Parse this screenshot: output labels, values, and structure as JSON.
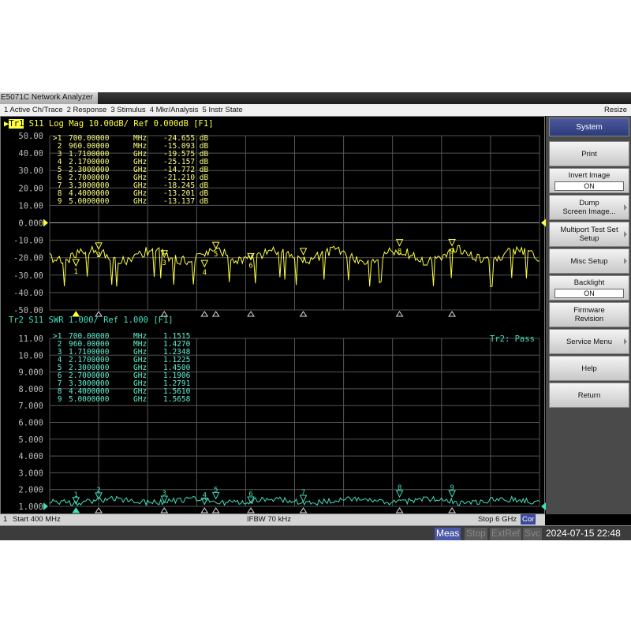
{
  "window": {
    "title": "E5071C Network Analyzer"
  },
  "menu": {
    "items": [
      "1 Active Ch/Trace",
      "2 Response",
      "3 Stimulus",
      "4 Mkr/Analysis",
      "5 Instr State"
    ],
    "resize": "Resize"
  },
  "trace1": {
    "tag": "Tr1",
    "header": " S11 Log Mag 10.00dB/ Ref 0.000dB [F1]",
    "color": "#ffff40",
    "yticks": [
      "50.00",
      "40.00",
      "30.00",
      "20.00",
      "10.00",
      "0.000",
      "-10.00",
      "-20.00",
      "-30.00",
      "-40.00",
      "-50.00"
    ],
    "markers": [
      {
        "id": ">1",
        "freq": "700.00000",
        "unit": "MHz",
        "value": "-24.655 dB"
      },
      {
        "id": " 2",
        "freq": "960.00000",
        "unit": "MHz",
        "value": "-15.093 dB"
      },
      {
        "id": " 3",
        "freq": "1.7100000",
        "unit": "GHz",
        "value": "-19.575 dB"
      },
      {
        "id": " 4",
        "freq": "2.1700000",
        "unit": "GHz",
        "value": "-25.157 dB"
      },
      {
        "id": " 5",
        "freq": "2.3000000",
        "unit": "GHz",
        "value": "-14.772 dB"
      },
      {
        "id": " 6",
        "freq": "2.7000000",
        "unit": "GHz",
        "value": "-21.210 dB"
      },
      {
        "id": " 7",
        "freq": "3.3000000",
        "unit": "GHz",
        "value": "-18.245 dB"
      },
      {
        "id": " 8",
        "freq": "4.4000000",
        "unit": "GHz",
        "value": "-13.201 dB"
      },
      {
        "id": " 9",
        "freq": "5.0000000",
        "unit": "GHz",
        "value": "-13.137 dB"
      }
    ]
  },
  "trace2": {
    "header": "Tr2 S11 SWR 1.000/ Ref 1.000 [F1]",
    "color": "#40e0c0",
    "pass": "Tr2: Pass",
    "yticks": [
      "11.00",
      "10.00",
      "9.000",
      "8.000",
      "7.000",
      "6.000",
      "5.000",
      "4.000",
      "3.000",
      "2.000",
      "1.000"
    ],
    "markers": [
      {
        "id": ">1",
        "freq": "700.00000",
        "unit": "MHz",
        "value": "1.1515"
      },
      {
        "id": " 2",
        "freq": "960.00000",
        "unit": "MHz",
        "value": "1.4270"
      },
      {
        "id": " 3",
        "freq": "1.7100000",
        "unit": "GHz",
        "value": "1.2348"
      },
      {
        "id": " 4",
        "freq": "2.1700000",
        "unit": "GHz",
        "value": "1.1225"
      },
      {
        "id": " 5",
        "freq": "2.3000000",
        "unit": "GHz",
        "value": "1.4500"
      },
      {
        "id": " 6",
        "freq": "2.7000000",
        "unit": "GHz",
        "value": "1.1906"
      },
      {
        "id": " 7",
        "freq": "3.3000000",
        "unit": "GHz",
        "value": "1.2791"
      },
      {
        "id": " 8",
        "freq": "4.4000000",
        "unit": "GHz",
        "value": "1.5610"
      },
      {
        "id": " 9",
        "freq": "5.0000000",
        "unit": "GHz",
        "value": "1.5658"
      }
    ]
  },
  "chart_data": {
    "type": "line",
    "x_range_ghz": [
      0.4,
      6
    ],
    "marker_freqs_ghz": [
      0.7,
      0.96,
      1.71,
      2.17,
      2.3,
      2.7,
      3.3,
      4.4,
      5.0
    ],
    "trace1_ylim": [
      -50,
      50
    ],
    "trace2_ylim": [
      1,
      11
    ],
    "trace1_marker_values": [
      -24.655,
      -15.093,
      -19.575,
      -25.157,
      -14.772,
      -21.21,
      -18.245,
      -13.201,
      -13.137
    ],
    "trace2_marker_values": [
      1.1515,
      1.427,
      1.2348,
      1.1225,
      1.45,
      1.1906,
      1.2791,
      1.561,
      1.5658
    ]
  },
  "status": {
    "channel": "1",
    "start": "Start 400 MHz",
    "ifbw": "IFBW 70 kHz",
    "stop": "Stop 6 GHz",
    "cor": "Cor"
  },
  "bottom": {
    "meas": "Meas",
    "stop": "Stop",
    "extref": "ExtRef",
    "svc": "Svc",
    "datetime": "2024-07-15 22:48"
  },
  "softkeys": {
    "title": "System",
    "print": "Print",
    "invert": "Invert Image",
    "invert_val": "ON",
    "dump": "Dump\nScreen Image...",
    "multiport": "Multiport Test Set\nSetup",
    "misc": "Misc Setup",
    "backlight": "Backlight",
    "backlight_val": "ON",
    "firmware": "Firmware\nRevision",
    "service": "Service Menu",
    "help": "Help",
    "return": "Return"
  }
}
